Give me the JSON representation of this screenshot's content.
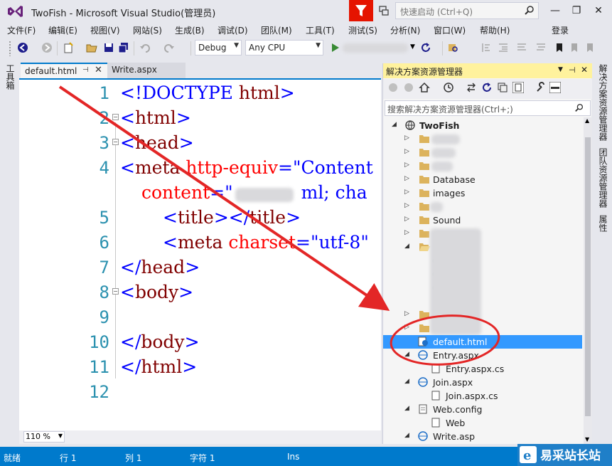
{
  "window": {
    "title": "TwoFish - Microsoft Visual Studio(管理员)",
    "quick_launch_placeholder": "快速启动 (Ctrl+Q)",
    "minimize": "—",
    "restore": "❐",
    "close": "✕"
  },
  "menu": [
    "文件(F)",
    "编辑(E)",
    "视图(V)",
    "网站(S)",
    "生成(B)",
    "调试(D)",
    "团队(M)",
    "工具(T)",
    "测试(S)",
    "分析(N)",
    "窗口(W)",
    "帮助(H)"
  ],
  "signin": "登录",
  "toolbar": {
    "config": "Debug",
    "platform": "Any CPU"
  },
  "left_strip_label": "工具箱",
  "tabs": [
    {
      "label": "default.html",
      "active": true
    },
    {
      "label": "Write.aspx",
      "active": false
    }
  ],
  "editor": {
    "line_numbers": [
      "1",
      "2",
      "3",
      "4",
      "",
      "5",
      "6",
      "7",
      "8",
      "9",
      "10",
      "11",
      "12"
    ],
    "zoom": "110 %"
  },
  "code": {
    "l1_lt": "<!DOCTYPE ",
    "l1_kw": "html",
    "l1_gt": ">",
    "l2_lt": "<",
    "l2_el": "html",
    "l2_gt": ">",
    "l3_lt": "<",
    "l3_el": "head",
    "l3_gt": ">",
    "l4_lt": "<",
    "l4_el": "meta",
    "l4_at": "http-equiv",
    "l4_eq": "=",
    "l4_st": "\"Content",
    "l4b_at": "content",
    "l4b_eq": "=",
    "l4b_st": "\"",
    "l4b_st2": "ml; cha",
    "l5_lt": "<",
    "l5_el": "title",
    "l5_mid": "></",
    "l5_el2": "title",
    "l5_gt": ">",
    "l6_lt": "<",
    "l6_el": "meta",
    "l6_at": "charset",
    "l6_eq": "=",
    "l6_st": "\"utf-8\"",
    "l7_lt": "</",
    "l7_el": "head",
    "l7_gt": ">",
    "l8_lt": "<",
    "l8_el": "body",
    "l8_gt": ">",
    "l10_lt": "</",
    "l10_el": "body",
    "l10_gt": ">",
    "l11_lt": "</",
    "l11_el": "html",
    "l11_gt": ">"
  },
  "solution_explorer": {
    "title": "解决方案资源管理器",
    "search_placeholder": "搜索解决方案资源管理器(Ctrl+;)",
    "root": "TwoFish",
    "items": {
      "database": "Database",
      "images": "images",
      "sound": "Sound",
      "default_html": "default.html",
      "entry_aspx": "Entry.aspx",
      "entry_cs": "Entry.aspx.cs",
      "join_aspx": "Join.aspx",
      "join_cs": "Join.aspx.cs",
      "web_config": "Web.config",
      "web_child": "Web",
      "write_aspx": "Write.asp"
    }
  },
  "right_strip": [
    "解决方案资源管理器",
    "团队资源管理器",
    "属性"
  ],
  "status": {
    "ready": "就绪",
    "line": "行 1",
    "col": "列 1",
    "char": "字符 1",
    "ins": "Ins"
  },
  "watermark": "易采站长站",
  "colors": {
    "accent": "#007acc",
    "selection": "#3399ff",
    "panel_title": "#fff29d",
    "annotation": "#e32626"
  }
}
